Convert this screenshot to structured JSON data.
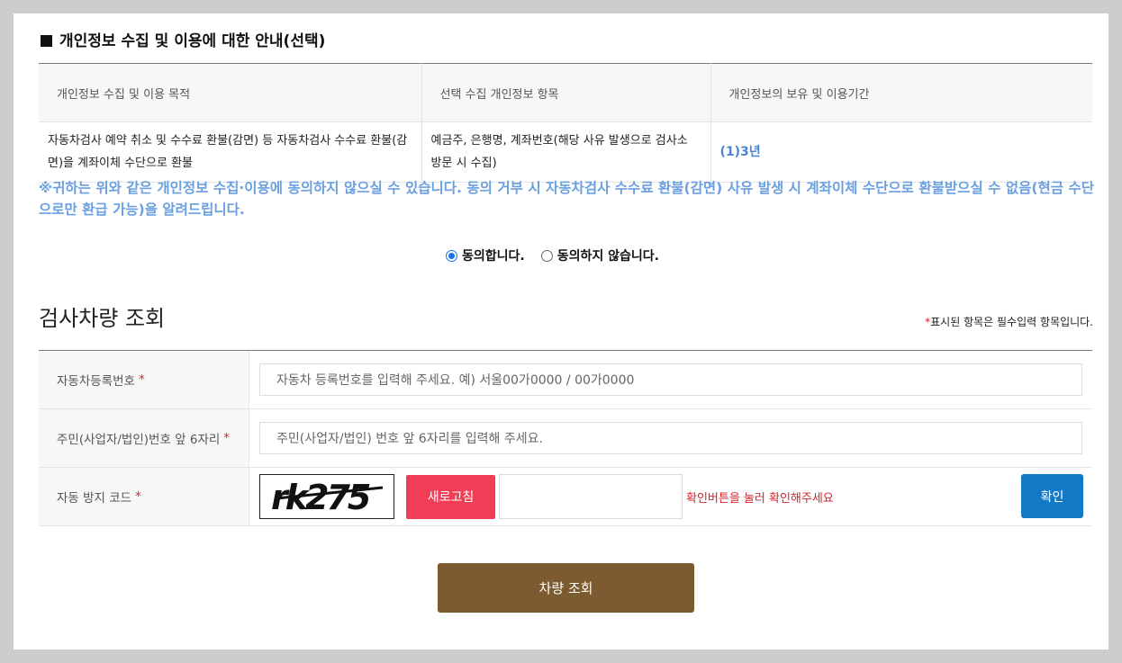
{
  "privacy": {
    "title": "개인정보 수집 및 이용에 대한 안내(선택)",
    "headers": [
      "개인정보 수집 및 이용 목적",
      "선택 수집 개인정보 항목",
      "개인정보의 보유 및 이용기간"
    ],
    "row": {
      "purpose": "자동차검사 예약 취소 및 수수료 환불(감면) 등 자동차검사 수수료 환불(감면)을 계좌이체 수단으로 환불",
      "items": "예금주, 은행명, 계좌번호(해당 사유 발생으로 검사소 방문 시 수집)",
      "period": "(1)3년"
    },
    "notice": "※귀하는 위와 같은 개인정보 수집·이용에 동의하지 않으실 수 있습니다. 동의 거부 시 자동차검사 수수료 환불(감면) 사유 발생 시 계좌이체 수단으로 환불받으실 수 없음(현금 수단으로만 환급 가능)을 알려드립니다.",
    "consent": {
      "agree": "동의합니다.",
      "disagree": "동의하지 않습니다.",
      "selected": "agree"
    }
  },
  "lookup": {
    "title": "검사차량 조회",
    "required_note": "표시된 항목은 필수입력 항목입니다.",
    "required_mark": "*",
    "fields": {
      "plate_label": "자동차등록번호",
      "plate_placeholder": "자동차 등록번호를 입력해 주세요. 예) 서울00가0000 / 00가0000",
      "id_label": "주민(사업자/법인)번호 앞 6자리",
      "id_placeholder": "주민(사업자/법인) 번호 앞 6자리를 입력해 주세요.",
      "captcha_label": "자동 방지 코드"
    },
    "captcha": {
      "text": "rk275",
      "refresh_label": "새로고침",
      "hint": "확인버튼을 눌러 확인해주세요",
      "confirm_label": "확인"
    },
    "submit_label": "차량 조회"
  },
  "colors": {
    "accent_blue": "#1378c6",
    "refresh_red": "#f23d57",
    "submit_brown": "#7c5b30",
    "notice_blue": "#6a9fe0",
    "required_red": "#d2232a"
  }
}
